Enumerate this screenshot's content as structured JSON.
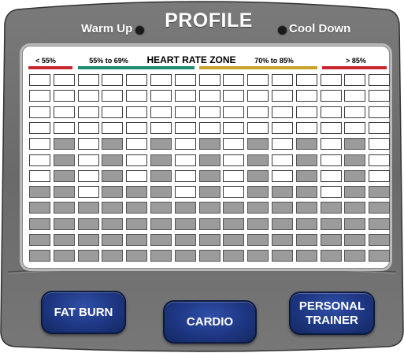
{
  "header": {
    "title": "PROFILE",
    "warm_up": "Warm Up",
    "cool_down": "Cool Down"
  },
  "heart_rate_zone": {
    "title": "HEART RATE ZONE",
    "zones": [
      {
        "label": "< 55%",
        "color": "#c8262e"
      },
      {
        "label": "55% to 69%",
        "color": "#1e8a6e"
      },
      {
        "label": "70% to 85%",
        "color": "#c9a227"
      },
      {
        "label": "> 85%",
        "color": "#c8262e"
      }
    ]
  },
  "profile_grid": {
    "columns": 15,
    "rows": 12,
    "levels": [
      5,
      8,
      4,
      8,
      5,
      8,
      4,
      8,
      4,
      8,
      5,
      8,
      4,
      8,
      5
    ]
  },
  "buttons": {
    "fat_burn": "FAT BURN",
    "cardio": "CARDIO",
    "personal_trainer_line1": "PERSONAL",
    "personal_trainer_line2": "TRAINER"
  },
  "colors": {
    "console_body": "#6d6d6d",
    "button_blue": "#1d3580",
    "lit_cell": "#9b9b9b"
  }
}
